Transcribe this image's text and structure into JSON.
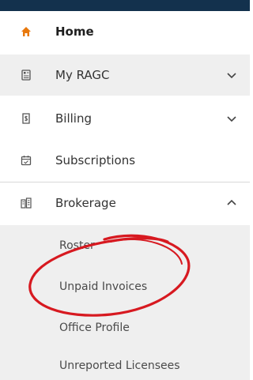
{
  "nav": {
    "items": [
      {
        "label": "Home",
        "icon": "home-icon"
      },
      {
        "label": "My RAGC",
        "icon": "id-card-icon",
        "expandable": true,
        "expanded": false
      },
      {
        "label": "Billing",
        "icon": "invoice-icon",
        "expandable": true,
        "expanded": false
      },
      {
        "label": "Subscriptions",
        "icon": "calendar-check-icon"
      },
      {
        "label": "Brokerage",
        "icon": "building-icon",
        "expandable": true,
        "expanded": true
      }
    ],
    "brokerage_subitems": [
      {
        "label": "Roster"
      },
      {
        "label": "Unpaid Invoices"
      },
      {
        "label": "Office Profile"
      },
      {
        "label": "Unreported Licensees"
      }
    ]
  },
  "colors": {
    "topbar": "#13314d",
    "home_icon": "#e8780c",
    "annotation": "#d71920"
  }
}
